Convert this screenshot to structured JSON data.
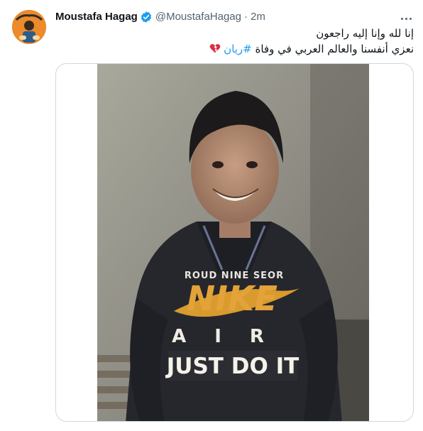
{
  "tweet": {
    "display_name": "Moustafa Hagag",
    "verified_icon": "verified-badge-icon",
    "handle": "@MoustafaHagag",
    "separator": "·",
    "time": "2m",
    "more_icon": "more-options-icon",
    "text_line1": "إنا لله وإنا إليه راجعون",
    "text_line2_prefix": "نعزي أنفسنا والعالم العربي في وفاة",
    "hashtag": "#ريان",
    "emoji_icon": "broken-heart-icon",
    "media_printed_text": "NIKE AIR JUST DO IT",
    "colors": {
      "accent": "#1d9bf0",
      "secondary_text": "#536471",
      "border": "#cfd9de",
      "broken_heart": "#dd2e44"
    }
  }
}
